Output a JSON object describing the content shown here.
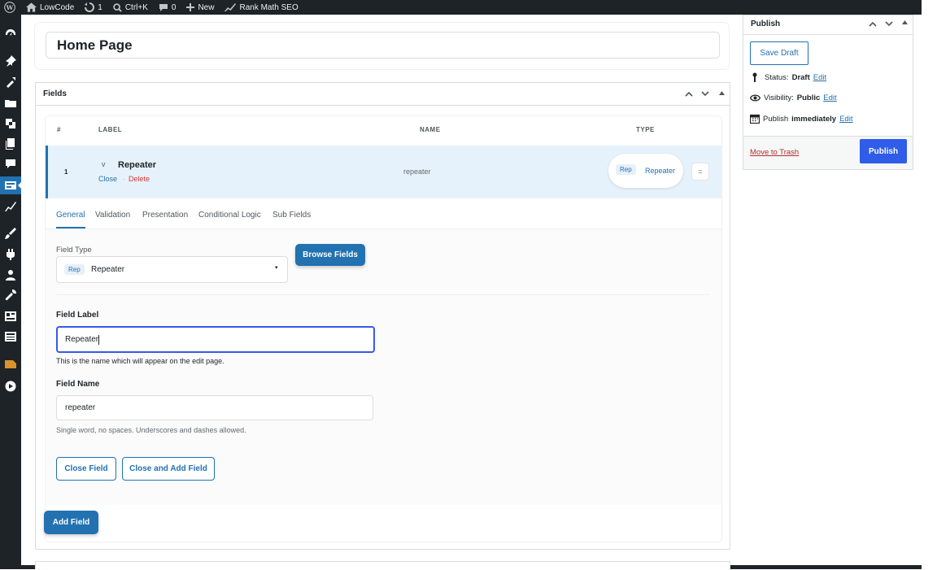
{
  "admin_bar": {
    "site_name": "LowCode",
    "updates_count": "1",
    "search_shortcut": "Ctrl+K",
    "comments_count": "0",
    "new_label": "New",
    "seo_label": "Rank Math SEO"
  },
  "title_input": {
    "value": "Home Page"
  },
  "fields_box": {
    "title": "Fields",
    "columns": [
      "#",
      "LABEL",
      "NAME",
      "TYPE"
    ],
    "row": {
      "order": "1",
      "label": "Repeater",
      "toggle": "v",
      "close_action": "Close",
      "separator": "·",
      "delete_action": "Delete",
      "name": "repeater",
      "type_badge": "Rep",
      "type_label": "Repeater",
      "menu_icon": "="
    },
    "tabs": [
      "General",
      "Validation",
      "Presentation",
      "Conditional Logic",
      "Sub Fields"
    ],
    "active_tab_index": 0,
    "field_type": {
      "label": "Field Type",
      "badge": "Rep",
      "value": "Repeater",
      "caret": "▾"
    },
    "browse_fields_label": "Browse Fields",
    "field_label": {
      "label": "Field Label",
      "value": "Repeater",
      "help": "This is the name which will appear on the edit page."
    },
    "field_name": {
      "label": "Field Name",
      "value": "repeater",
      "help": "Single word, no spaces. Underscores and dashes allowed."
    },
    "close_field_label": "Close Field",
    "close_and_add_label": "Close and Add Field",
    "add_field_label": "Add Field"
  },
  "publish_box": {
    "title": "Publish",
    "save_draft_label": "Save Draft",
    "status_prefix": "Status:",
    "status_value": "Draft",
    "visibility_prefix": "Visibility:",
    "visibility_value": "Public",
    "publish_prefix": "Publish",
    "publish_value": "immediately",
    "edit_label": "Edit",
    "trash_label": "Move to Trash",
    "publish_label": "Publish"
  },
  "colors": {
    "accent": "#2271b1",
    "delete": "#d63638",
    "admin_bar": "#1d2327",
    "row_highlight": "#e6f2fb"
  }
}
